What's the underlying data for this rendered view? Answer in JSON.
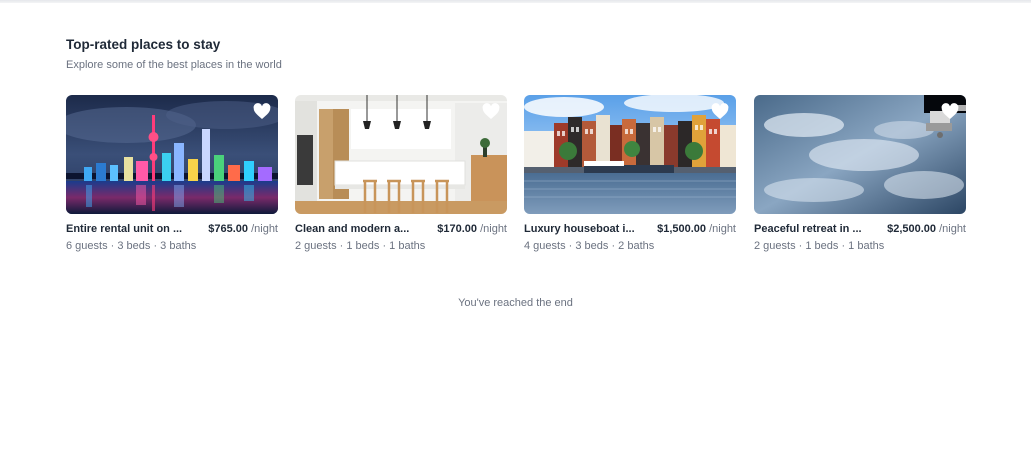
{
  "header": {
    "title": "Top-rated places to stay",
    "subtitle": "Explore some of the best places in the world"
  },
  "listings": [
    {
      "name": "Entire rental unit on ...",
      "price": "$765.00",
      "per": "/night",
      "details": "6 guests · 3 beds · 3 baths",
      "image": "city-skyline-night"
    },
    {
      "name": "Clean and modern a...",
      "price": "$170.00",
      "per": "/night",
      "details": "2 guests · 1 beds · 1 baths",
      "image": "modern-kitchen"
    },
    {
      "name": "Luxury houseboat i...",
      "price": "$1,500.00",
      "per": "/night",
      "details": "4 guests · 3 beds · 2 baths",
      "image": "canal-houses"
    },
    {
      "name": "Peaceful retreat in ...",
      "price": "$2,500.00",
      "per": "/night",
      "details": "2 guests · 1 beds · 1 baths",
      "image": "earth-from-space"
    }
  ],
  "footer": {
    "end_text": "You've reached the end"
  },
  "icons": {
    "favorite": "heart-icon"
  },
  "colors": {
    "title": "#1f2937",
    "muted": "#6b7280",
    "heart": "#ffffff"
  }
}
